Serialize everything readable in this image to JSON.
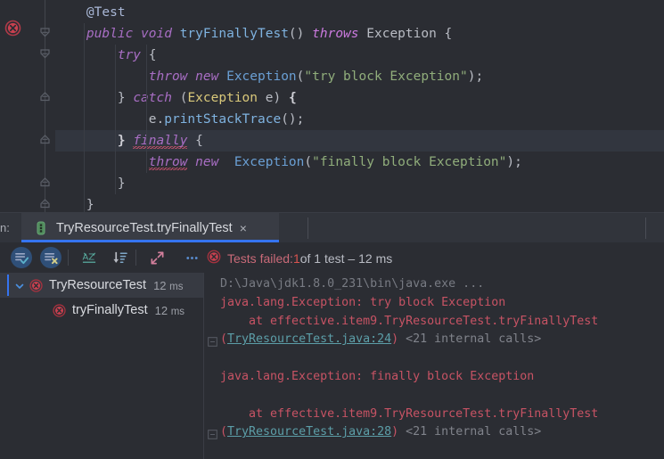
{
  "editor": {
    "lines": [
      {
        "indent": 4,
        "tokens": [
          {
            "t": "@Test",
            "c": "annot"
          }
        ]
      },
      {
        "indent": 4,
        "tokens": [
          {
            "t": "public",
            "c": "kw"
          },
          {
            "t": " ",
            "c": "punc"
          },
          {
            "t": "void",
            "c": "kw"
          },
          {
            "t": " ",
            "c": "punc"
          },
          {
            "t": "tryFinallyTest",
            "c": "mth"
          },
          {
            "t": "() ",
            "c": "punc"
          },
          {
            "t": "throws",
            "c": "kw2"
          },
          {
            "t": " ",
            "c": "punc"
          },
          {
            "t": "Exception",
            "c": "ident"
          },
          {
            "t": " {",
            "c": "punc"
          }
        ]
      },
      {
        "indent": 8,
        "tokens": [
          {
            "t": "try",
            "c": "kw"
          },
          {
            "t": " {",
            "c": "punc"
          }
        ]
      },
      {
        "indent": 12,
        "tokens": [
          {
            "t": "throw",
            "c": "kw"
          },
          {
            "t": " ",
            "c": "punc"
          },
          {
            "t": "new",
            "c": "kw"
          },
          {
            "t": " ",
            "c": "punc"
          },
          {
            "t": "Exception",
            "c": "type"
          },
          {
            "t": "(",
            "c": "punc"
          },
          {
            "t": "\"try block Exception\"",
            "c": "str"
          },
          {
            "t": ");",
            "c": "punc"
          }
        ]
      },
      {
        "indent": 8,
        "tokens": [
          {
            "t": "} ",
            "c": "punc"
          },
          {
            "t": "catch",
            "c": "kw"
          },
          {
            "t": " (",
            "c": "punc"
          },
          {
            "t": "Exception",
            "c": "typey"
          },
          {
            "t": " e) ",
            "c": "punc"
          },
          {
            "t": "{",
            "c": "brace-hl"
          }
        ]
      },
      {
        "indent": 12,
        "tokens": [
          {
            "t": "e",
            "c": "ident"
          },
          {
            "t": ".",
            "c": "punc"
          },
          {
            "t": "printStackTrace",
            "c": "mth"
          },
          {
            "t": "();",
            "c": "punc"
          }
        ]
      },
      {
        "indent": 8,
        "tokens": [
          {
            "t": "}",
            "c": "brace-hl"
          },
          {
            "t": " ",
            "c": "punc"
          },
          {
            "t": "finally",
            "c": "kw squig"
          },
          {
            "t": " {",
            "c": "punc"
          }
        ]
      },
      {
        "indent": 12,
        "tokens": [
          {
            "t": "throw",
            "c": "kw squig"
          },
          {
            "t": " ",
            "c": "punc"
          },
          {
            "t": "new",
            "c": "kw"
          },
          {
            "t": "  ",
            "c": "punc"
          },
          {
            "t": "Exception",
            "c": "type"
          },
          {
            "t": "(",
            "c": "punc"
          },
          {
            "t": "\"finally block Exception\"",
            "c": "str"
          },
          {
            "t": ");",
            "c": "punc"
          }
        ]
      },
      {
        "indent": 8,
        "tokens": [
          {
            "t": "}",
            "c": "punc"
          }
        ]
      },
      {
        "indent": 4,
        "tokens": [
          {
            "t": "}",
            "c": "punc"
          }
        ]
      }
    ],
    "highlighted_line_index": 6,
    "gutter": {
      "run_marker_icon": "run-test-failed-icon",
      "fold_icons": [
        "fold-collapse-icon",
        "fold-collapse-icon",
        "fold-region-icon",
        "fold-region-icon",
        "fold-region-icon",
        "fold-region-icon"
      ]
    }
  },
  "tabbar": {
    "run_label": "n:",
    "tab": {
      "icon": "test-method-icon",
      "title": "TryResourceTest.tryFinallyTest",
      "close": "×"
    }
  },
  "toolbar": {
    "buttons": [
      {
        "name": "show-passed-toggle",
        "icon": "list-check-icon",
        "active": true
      },
      {
        "name": "hide-ignored-toggle",
        "icon": "list-x-icon",
        "active": true
      },
      {
        "name": "sort-alphabetically-button",
        "icon": "sort-az-icon",
        "active": false
      },
      {
        "name": "sort-by-duration-button",
        "icon": "sort-duration-icon",
        "active": false
      },
      {
        "name": "expand-all-button",
        "icon": "expand-arrows-icon",
        "active": false
      },
      {
        "name": "more-options-button",
        "icon": "ellipsis-icon",
        "active": false
      }
    ],
    "status": {
      "icon": "error-circle-icon",
      "prefix": "Tests failed: ",
      "failed_count": "1",
      "suffix": " of 1 test – 12 ms"
    }
  },
  "tree": {
    "rows": [
      {
        "indent": 0,
        "expanded": true,
        "selected": true,
        "chevron": "chevron-down-icon",
        "icon": "test-failed-icon",
        "label": "TryResourceTest",
        "time": "12",
        "unit": "ms"
      },
      {
        "indent": 1,
        "expanded": false,
        "selected": false,
        "chevron": "",
        "icon": "test-failed-icon",
        "label": "tryFinallyTest",
        "time": "12",
        "unit": "ms"
      }
    ]
  },
  "console": {
    "lines": [
      {
        "segments": [
          {
            "t": "D:\\Java\\jdk1.8.0_231\\bin\\java.exe ...",
            "c": "c-dim"
          }
        ]
      },
      {
        "segments": [
          {
            "t": "java.lang.Exception: try block Exception",
            "c": "c-err"
          }
        ]
      },
      {
        "segments": [
          {
            "t": "    at effective.item9.TryResourceTest.tryFinallyTest",
            "c": "c-err"
          }
        ]
      },
      {
        "segments": [
          {
            "t": "(",
            "c": "c-err"
          },
          {
            "t": "TryResourceTest.java:24",
            "c": "c-link"
          },
          {
            "t": ") ",
            "c": "c-err"
          },
          {
            "t": "<21 internal calls>",
            "c": "c-gray"
          }
        ],
        "fold": true
      },
      {
        "segments": [
          {
            "t": "",
            "c": "c-err"
          }
        ]
      },
      {
        "segments": [
          {
            "t": "java.lang.Exception: finally block Exception",
            "c": "c-err"
          }
        ]
      },
      {
        "segments": [
          {
            "t": "",
            "c": "c-err"
          }
        ]
      },
      {
        "segments": [
          {
            "t": "    at effective.item9.TryResourceTest.tryFinallyTest",
            "c": "c-err"
          }
        ]
      },
      {
        "segments": [
          {
            "t": "(",
            "c": "c-err"
          },
          {
            "t": "TryResourceTest.java:28",
            "c": "c-link"
          },
          {
            "t": ") ",
            "c": "c-err"
          },
          {
            "t": "<21 internal calls>",
            "c": "c-gray"
          }
        ],
        "fold": true
      }
    ]
  },
  "colors": {
    "background": "#2b2d33",
    "tab_accent": "#3574f0",
    "error_red": "#c75364",
    "link_teal": "#5c9ea8",
    "string_green": "#90ad7b",
    "keyword_purple": "#a86ec4"
  }
}
